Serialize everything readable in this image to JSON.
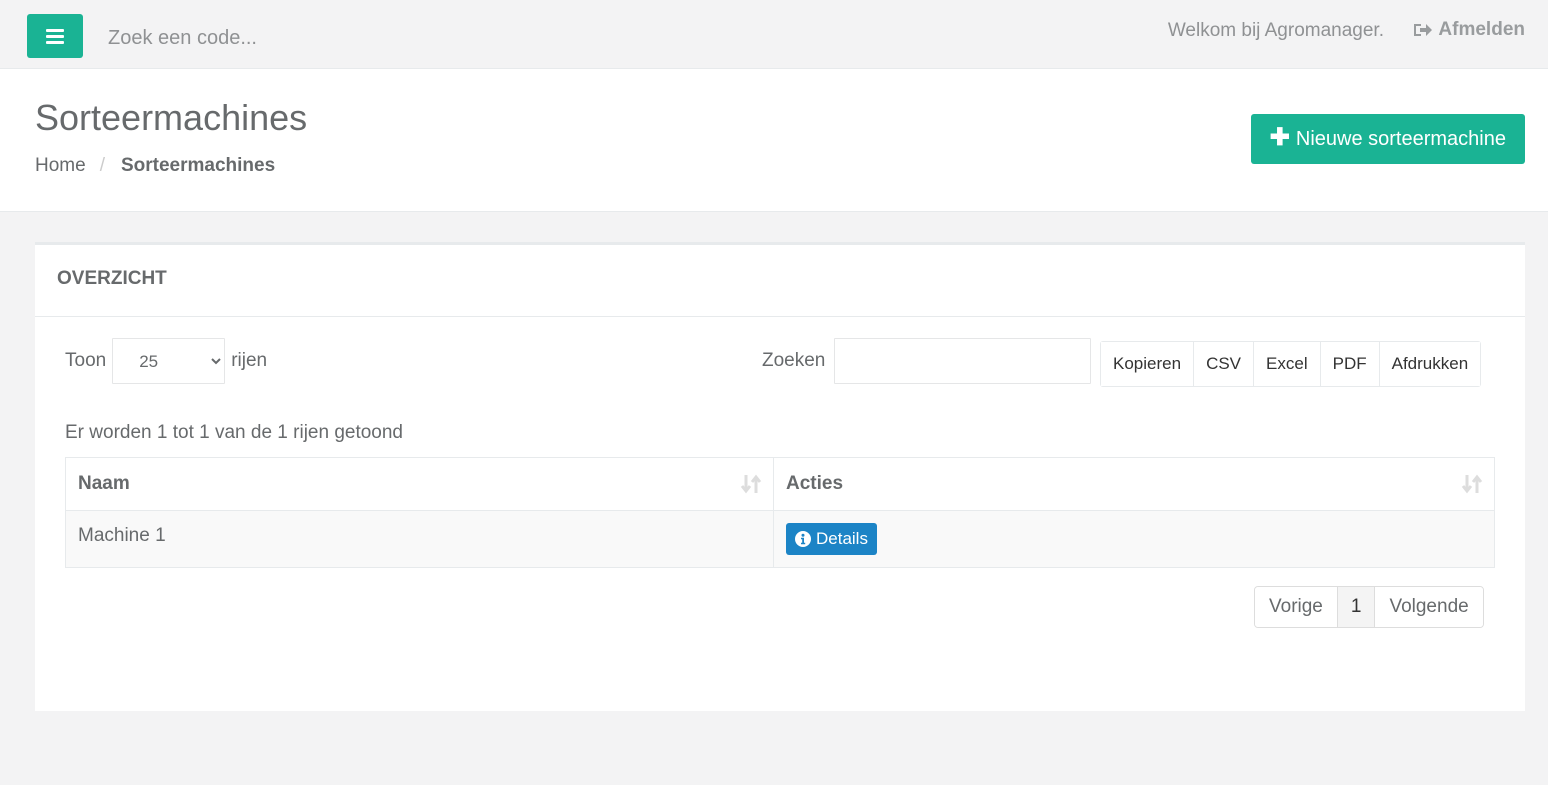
{
  "topbar": {
    "search_placeholder": "Zoek een code...",
    "welcome_text": "Welkom bij Agromanager.",
    "logout_label": "Afmelden"
  },
  "heading": {
    "title": "Sorteermachines",
    "breadcrumb": {
      "home": "Home",
      "separator": "/",
      "current": "Sorteermachines"
    },
    "new_button_label": "Nieuwe sorteermachine"
  },
  "panel": {
    "title": "OVERZICHT",
    "length_prefix": "Toon",
    "length_value": "25",
    "length_options": [
      "25"
    ],
    "length_suffix": "rijen",
    "search_label": "Zoeken",
    "search_value": "",
    "export_buttons": [
      "Kopieren",
      "CSV",
      "Excel",
      "PDF",
      "Afdrukken"
    ],
    "info_text": "Er worden 1 tot 1 van de 1 rijen getoond",
    "table": {
      "columns": [
        "Naam",
        "Acties"
      ],
      "rows": [
        {
          "naam": "Machine 1",
          "action_label": "Details"
        }
      ]
    },
    "pagination": {
      "prev": "Vorige",
      "current_page": "1",
      "next": "Volgende"
    }
  },
  "colors": {
    "primary": "#1ab394",
    "info": "#1c84c6",
    "text": "#676a6c",
    "background": "#f3f3f4"
  },
  "icons": {
    "menu": "bars-icon",
    "logout": "sign-out-icon",
    "new": "plus-icon",
    "sort": "sort-icon",
    "details": "info-circle-icon"
  }
}
